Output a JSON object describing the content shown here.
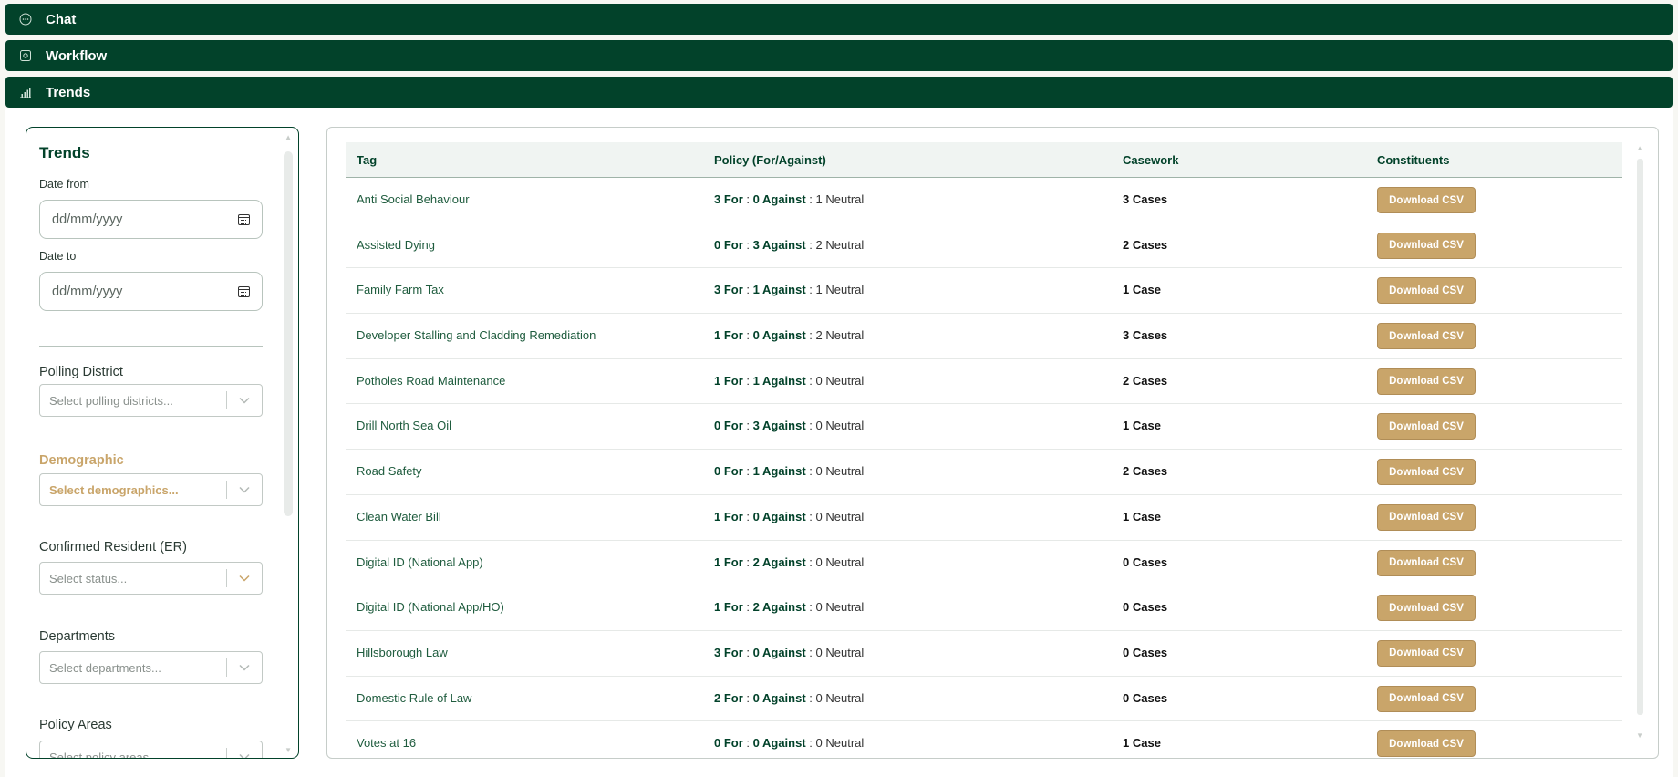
{
  "sections": {
    "chat": "Chat",
    "workflow": "Workflow",
    "trends": "Trends"
  },
  "filters": {
    "title": "Trends",
    "date_from_label": "Date from",
    "date_from_placeholder": "dd/mm/yyyy",
    "date_to_label": "Date to",
    "date_to_placeholder": "dd/mm/yyyy",
    "polling_district_label": "Polling District",
    "polling_district_placeholder": "Select polling districts...",
    "demographic_label": "Demographic",
    "demographic_placeholder": "Select demographics...",
    "confirmed_resident_label": "Confirmed Resident (ER)",
    "confirmed_resident_placeholder": "Select status...",
    "departments_label": "Departments",
    "departments_placeholder": "Select departments...",
    "policy_areas_label": "Policy Areas",
    "policy_areas_placeholder": "Select policy areas..."
  },
  "table": {
    "headers": {
      "tag": "Tag",
      "policy": "Policy (For/Against)",
      "casework": "Casework",
      "constituents": "Constituents"
    },
    "download_label": "Download CSV",
    "rows": [
      {
        "tag": "Anti Social Behaviour",
        "for": "3 For",
        "against": "0 Against",
        "neutral": "1 Neutral",
        "cases": "3 Cases"
      },
      {
        "tag": "Assisted Dying",
        "for": "0 For",
        "against": "3 Against",
        "neutral": "2 Neutral",
        "cases": "2 Cases"
      },
      {
        "tag": "Family Farm Tax",
        "for": "3 For",
        "against": "1 Against",
        "neutral": "1 Neutral",
        "cases": "1 Case"
      },
      {
        "tag": "Developer Stalling and Cladding Remediation",
        "for": "1 For",
        "against": "0 Against",
        "neutral": "2 Neutral",
        "cases": "3 Cases"
      },
      {
        "tag": "Potholes Road Maintenance",
        "for": "1 For",
        "against": "1 Against",
        "neutral": "0 Neutral",
        "cases": "2 Cases"
      },
      {
        "tag": "Drill North Sea Oil",
        "for": "0 For",
        "against": "3 Against",
        "neutral": "0 Neutral",
        "cases": "1 Case"
      },
      {
        "tag": "Road Safety",
        "for": "0 For",
        "against": "1 Against",
        "neutral": "0 Neutral",
        "cases": "2 Cases"
      },
      {
        "tag": "Clean Water Bill",
        "for": "1 For",
        "against": "0 Against",
        "neutral": "0 Neutral",
        "cases": "1 Case"
      },
      {
        "tag": "Digital ID (National App)",
        "for": "1 For",
        "against": "2 Against",
        "neutral": "0 Neutral",
        "cases": "0 Cases"
      },
      {
        "tag": "Digital ID (National App/HO)",
        "for": "1 For",
        "against": "2 Against",
        "neutral": "0 Neutral",
        "cases": "0 Cases"
      },
      {
        "tag": "Hillsborough Law",
        "for": "3 For",
        "against": "0 Against",
        "neutral": "0 Neutral",
        "cases": "0 Cases"
      },
      {
        "tag": "Domestic Rule of Law",
        "for": "2 For",
        "against": "0 Against",
        "neutral": "0 Neutral",
        "cases": "0 Cases"
      },
      {
        "tag": "Votes at 16",
        "for": "0 For",
        "against": "0 Against",
        "neutral": "0 Neutral",
        "cases": "1 Case"
      }
    ]
  },
  "colors": {
    "primary_green": "#02422a",
    "accent_gold": "#c9a56a"
  },
  "icons": {
    "chat": "chat-bubble-icon",
    "workflow": "workflow-icon",
    "trends": "bar-chart-icon",
    "calendar": "calendar-icon",
    "chevron": "chevron-down-icon"
  }
}
